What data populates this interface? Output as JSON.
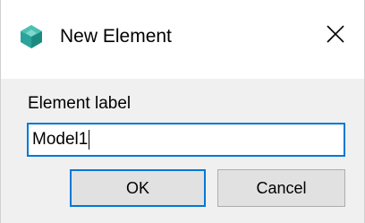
{
  "window": {
    "title": "New Element",
    "icon": "app-logo-icon",
    "close_icon": "close-icon"
  },
  "form": {
    "label": "Element label",
    "input_value": "Model1"
  },
  "buttons": {
    "ok_label": "OK",
    "cancel_label": "Cancel"
  },
  "colors": {
    "focus_accent": "#0078d7",
    "icon_teal": "#2aa39a"
  }
}
